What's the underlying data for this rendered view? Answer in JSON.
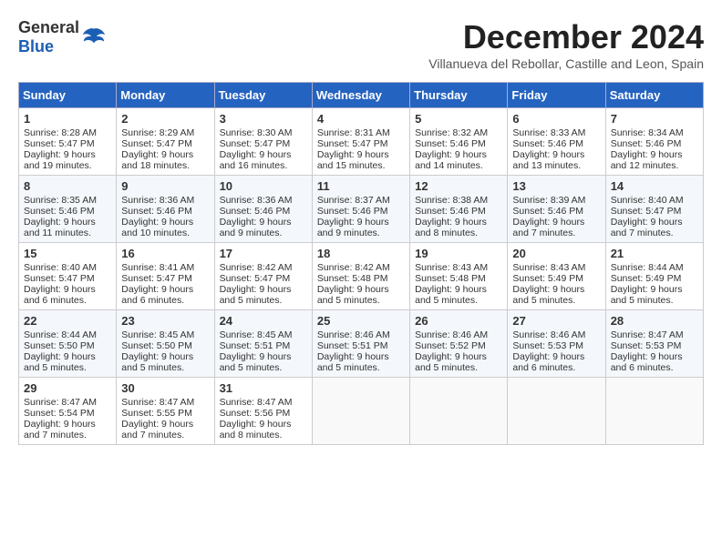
{
  "header": {
    "logo_general": "General",
    "logo_blue": "Blue",
    "month_title": "December 2024",
    "location": "Villanueva del Rebollar, Castille and Leon, Spain"
  },
  "weekdays": [
    "Sunday",
    "Monday",
    "Tuesday",
    "Wednesday",
    "Thursday",
    "Friday",
    "Saturday"
  ],
  "weeks": [
    [
      {
        "day": "1",
        "sunrise": "8:28 AM",
        "sunset": "5:47 PM",
        "daylight": "9 hours and 19 minutes."
      },
      {
        "day": "2",
        "sunrise": "8:29 AM",
        "sunset": "5:47 PM",
        "daylight": "9 hours and 18 minutes."
      },
      {
        "day": "3",
        "sunrise": "8:30 AM",
        "sunset": "5:47 PM",
        "daylight": "9 hours and 16 minutes."
      },
      {
        "day": "4",
        "sunrise": "8:31 AM",
        "sunset": "5:47 PM",
        "daylight": "9 hours and 15 minutes."
      },
      {
        "day": "5",
        "sunrise": "8:32 AM",
        "sunset": "5:46 PM",
        "daylight": "9 hours and 14 minutes."
      },
      {
        "day": "6",
        "sunrise": "8:33 AM",
        "sunset": "5:46 PM",
        "daylight": "9 hours and 13 minutes."
      },
      {
        "day": "7",
        "sunrise": "8:34 AM",
        "sunset": "5:46 PM",
        "daylight": "9 hours and 12 minutes."
      }
    ],
    [
      {
        "day": "8",
        "sunrise": "8:35 AM",
        "sunset": "5:46 PM",
        "daylight": "9 hours and 11 minutes."
      },
      {
        "day": "9",
        "sunrise": "8:36 AM",
        "sunset": "5:46 PM",
        "daylight": "9 hours and 10 minutes."
      },
      {
        "day": "10",
        "sunrise": "8:36 AM",
        "sunset": "5:46 PM",
        "daylight": "9 hours and 9 minutes."
      },
      {
        "day": "11",
        "sunrise": "8:37 AM",
        "sunset": "5:46 PM",
        "daylight": "9 hours and 9 minutes."
      },
      {
        "day": "12",
        "sunrise": "8:38 AM",
        "sunset": "5:46 PM",
        "daylight": "9 hours and 8 minutes."
      },
      {
        "day": "13",
        "sunrise": "8:39 AM",
        "sunset": "5:46 PM",
        "daylight": "9 hours and 7 minutes."
      },
      {
        "day": "14",
        "sunrise": "8:40 AM",
        "sunset": "5:47 PM",
        "daylight": "9 hours and 7 minutes."
      }
    ],
    [
      {
        "day": "15",
        "sunrise": "8:40 AM",
        "sunset": "5:47 PM",
        "daylight": "9 hours and 6 minutes."
      },
      {
        "day": "16",
        "sunrise": "8:41 AM",
        "sunset": "5:47 PM",
        "daylight": "9 hours and 6 minutes."
      },
      {
        "day": "17",
        "sunrise": "8:42 AM",
        "sunset": "5:47 PM",
        "daylight": "9 hours and 5 minutes."
      },
      {
        "day": "18",
        "sunrise": "8:42 AM",
        "sunset": "5:48 PM",
        "daylight": "9 hours and 5 minutes."
      },
      {
        "day": "19",
        "sunrise": "8:43 AM",
        "sunset": "5:48 PM",
        "daylight": "9 hours and 5 minutes."
      },
      {
        "day": "20",
        "sunrise": "8:43 AM",
        "sunset": "5:49 PM",
        "daylight": "9 hours and 5 minutes."
      },
      {
        "day": "21",
        "sunrise": "8:44 AM",
        "sunset": "5:49 PM",
        "daylight": "9 hours and 5 minutes."
      }
    ],
    [
      {
        "day": "22",
        "sunrise": "8:44 AM",
        "sunset": "5:50 PM",
        "daylight": "9 hours and 5 minutes."
      },
      {
        "day": "23",
        "sunrise": "8:45 AM",
        "sunset": "5:50 PM",
        "daylight": "9 hours and 5 minutes."
      },
      {
        "day": "24",
        "sunrise": "8:45 AM",
        "sunset": "5:51 PM",
        "daylight": "9 hours and 5 minutes."
      },
      {
        "day": "25",
        "sunrise": "8:46 AM",
        "sunset": "5:51 PM",
        "daylight": "9 hours and 5 minutes."
      },
      {
        "day": "26",
        "sunrise": "8:46 AM",
        "sunset": "5:52 PM",
        "daylight": "9 hours and 5 minutes."
      },
      {
        "day": "27",
        "sunrise": "8:46 AM",
        "sunset": "5:53 PM",
        "daylight": "9 hours and 6 minutes."
      },
      {
        "day": "28",
        "sunrise": "8:47 AM",
        "sunset": "5:53 PM",
        "daylight": "9 hours and 6 minutes."
      }
    ],
    [
      {
        "day": "29",
        "sunrise": "8:47 AM",
        "sunset": "5:54 PM",
        "daylight": "9 hours and 7 minutes."
      },
      {
        "day": "30",
        "sunrise": "8:47 AM",
        "sunset": "5:55 PM",
        "daylight": "9 hours and 7 minutes."
      },
      {
        "day": "31",
        "sunrise": "8:47 AM",
        "sunset": "5:56 PM",
        "daylight": "9 hours and 8 minutes."
      },
      null,
      null,
      null,
      null
    ]
  ]
}
